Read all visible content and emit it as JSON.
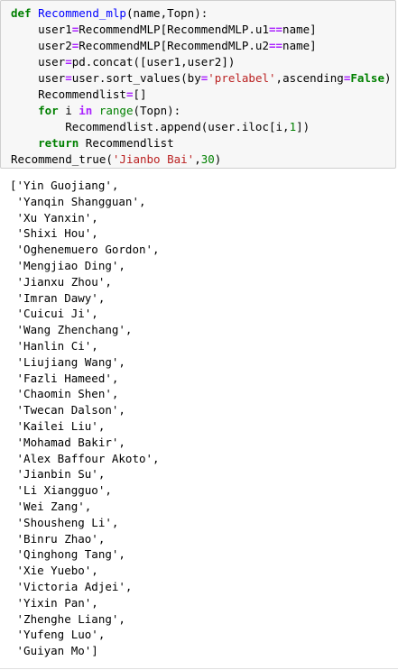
{
  "code_cell": {
    "lines": [
      [
        {
          "t": "def ",
          "c": "kw"
        },
        {
          "t": "Recommend_mlp",
          "c": "fn"
        },
        {
          "t": "(name,Topn):",
          "c": ""
        }
      ],
      [
        {
          "t": "    user1",
          "c": ""
        },
        {
          "t": "=",
          "c": "op"
        },
        {
          "t": "RecommendMLP[RecommendMLP.u1",
          "c": ""
        },
        {
          "t": "==",
          "c": "op"
        },
        {
          "t": "name]",
          "c": ""
        }
      ],
      [
        {
          "t": "    user2",
          "c": ""
        },
        {
          "t": "=",
          "c": "op"
        },
        {
          "t": "RecommendMLP[RecommendMLP.u2",
          "c": ""
        },
        {
          "t": "==",
          "c": "op"
        },
        {
          "t": "name]",
          "c": ""
        }
      ],
      [
        {
          "t": "    user",
          "c": ""
        },
        {
          "t": "=",
          "c": "op"
        },
        {
          "t": "pd.concat([user1,user2])",
          "c": ""
        }
      ],
      [
        {
          "t": "    user",
          "c": ""
        },
        {
          "t": "=",
          "c": "op"
        },
        {
          "t": "user.sort_values(by",
          "c": ""
        },
        {
          "t": "=",
          "c": "op"
        },
        {
          "t": "'prelabel'",
          "c": "str"
        },
        {
          "t": ",ascending",
          "c": ""
        },
        {
          "t": "=",
          "c": "op"
        },
        {
          "t": "False",
          "c": "kw"
        },
        {
          "t": ")",
          "c": ""
        }
      ],
      [
        {
          "t": "    Recommendlist",
          "c": ""
        },
        {
          "t": "=",
          "c": "op"
        },
        {
          "t": "[]",
          "c": ""
        }
      ],
      [
        {
          "t": "    ",
          "c": ""
        },
        {
          "t": "for",
          "c": "kw"
        },
        {
          "t": " i ",
          "c": ""
        },
        {
          "t": "in",
          "c": "op"
        },
        {
          "t": " ",
          "c": ""
        },
        {
          "t": "range",
          "c": "bi"
        },
        {
          "t": "(Topn):",
          "c": ""
        }
      ],
      [
        {
          "t": "        Recommendlist.append(user.iloc[i,",
          "c": ""
        },
        {
          "t": "1",
          "c": "num"
        },
        {
          "t": "])",
          "c": ""
        }
      ],
      [
        {
          "t": "    ",
          "c": ""
        },
        {
          "t": "return",
          "c": "kw"
        },
        {
          "t": " Recommendlist",
          "c": ""
        }
      ],
      [
        {
          "t": "Recommend_true(",
          "c": ""
        },
        {
          "t": "'Jianbo Bai'",
          "c": "str"
        },
        {
          "t": ",",
          "c": ""
        },
        {
          "t": "30",
          "c": "num"
        },
        {
          "t": ")",
          "c": ""
        }
      ]
    ]
  },
  "output_cell": {
    "lines": [
      "['Yin Guojiang',",
      " 'Yanqin Shangguan',",
      " 'Xu Yanxin',",
      " 'Shixi Hou',",
      " 'Oghenemuero Gordon',",
      " 'Mengjiao Ding',",
      " 'Jianxu Zhou',",
      " 'Imran Dawy',",
      " 'Cuicui Ji',",
      " 'Wang Zhenchang',",
      " 'Hanlin Ci',",
      " 'Liujiang Wang',",
      " 'Fazli Hameed',",
      " 'Chaomin Shen',",
      " 'Twecan Dalson',",
      " 'Kailei Liu',",
      " 'Mohamad Bakir',",
      " 'Alex Baffour Akoto',",
      " 'Jianbin Su',",
      " 'Li Xiangguo',",
      " 'Wei Zang',",
      " 'Shousheng Li',",
      " 'Binru Zhao',",
      " 'Qinghong Tang',",
      " 'Xie Yuebo',",
      " 'Victoria Adjei',",
      " 'Yixin Pan',",
      " 'Zhenghe Liang',",
      " 'Yufeng Luo',",
      " 'Guiyan Mo']"
    ]
  },
  "colors": {
    "cell_bg": "#f7f7f7",
    "cell_border": "#cfcfcf",
    "keyword": "#008000",
    "function_name": "#0000ff",
    "string": "#ba2121",
    "operator": "#aa22ff"
  }
}
